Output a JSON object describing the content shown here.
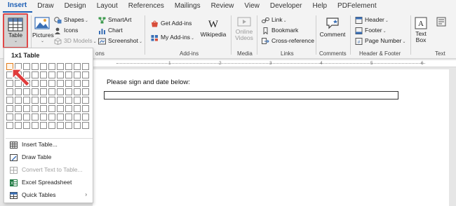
{
  "tabs": [
    "Insert",
    "Draw",
    "Design",
    "Layout",
    "References",
    "Mailings",
    "Review",
    "View",
    "Developer",
    "Help",
    "PDFelement"
  ],
  "ribbon": {
    "table_label": "Table",
    "pictures_label": "Pictures",
    "shapes_label": "Shapes",
    "icons_label": "Icons",
    "models_label": "3D Models",
    "smartart_label": "SmartArt",
    "chart_label": "Chart",
    "screenshot_label": "Screenshot",
    "illustrations_group_tail": "ons",
    "getaddins_label": "Get Add-ins",
    "myaddins_label": "My Add-ins",
    "wikipedia_label": "Wikipedia",
    "addins_group": "Add-ins",
    "online_videos_line1": "Online",
    "online_videos_line2": "Videos",
    "media_group": "Media",
    "link_label": "Link",
    "bookmark_label": "Bookmark",
    "crossref_label": "Cross-reference",
    "links_group": "Links",
    "comment_label": "Comment",
    "comments_group": "Comments",
    "header_label": "Header",
    "footer_label": "Footer",
    "pagenumber_label": "Page Number",
    "hf_group": "Header & Footer",
    "textbox_line1": "Text",
    "textbox_line2": "Box",
    "text_group": "Text"
  },
  "ruler": {
    "numbers": [
      "1",
      "2",
      "3",
      "4",
      "5",
      "6"
    ]
  },
  "document": {
    "text": "Please sign and date below:"
  },
  "dropdown": {
    "grid_title": "1x1 Table",
    "grid_rows": 8,
    "grid_cols": 10,
    "selected_rows": 1,
    "selected_cols": 1,
    "items": [
      {
        "label": "Insert Table...",
        "icon": "table-grid-icon",
        "enabled": true
      },
      {
        "label": "Draw Table",
        "icon": "pencil-icon",
        "enabled": true
      },
      {
        "label": "Convert Text to Table...",
        "icon": "convert-table-icon",
        "enabled": false
      },
      {
        "label": "Excel Spreadsheet",
        "icon": "excel-icon",
        "enabled": true
      },
      {
        "label": "Quick Tables",
        "icon": "quick-tables-icon",
        "enabled": true,
        "submenu": true
      }
    ]
  },
  "colors": {
    "accent": "#1d5fb5",
    "highlight_border": "#e04848",
    "selection": "#e07b1a"
  }
}
